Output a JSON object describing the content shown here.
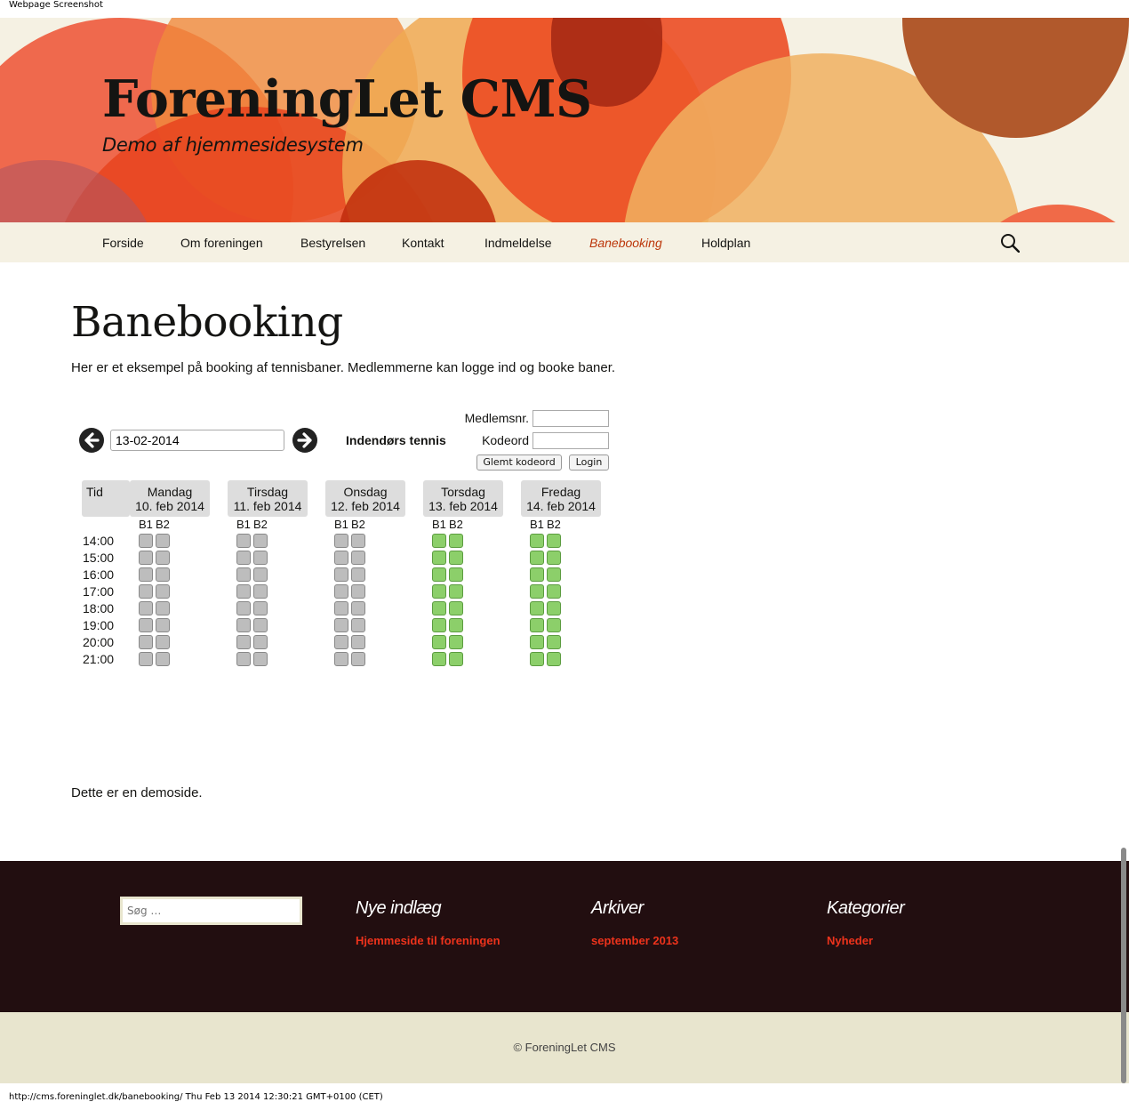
{
  "captions": {
    "top": "Webpage Screenshot",
    "bottom": "http://cms.foreninglet.dk/banebooking/ Thu Feb 13 2014 12:30:21 GMT+0100 (CET)"
  },
  "header": {
    "site_title": "ForeningLet CMS",
    "site_description": "Demo af hjemmesidesystem"
  },
  "nav": {
    "items": [
      {
        "label": "Forside"
      },
      {
        "label": "Om foreningen"
      },
      {
        "label": "Bestyrelsen"
      },
      {
        "label": "Kontakt"
      },
      {
        "label": "Indmeldelse"
      },
      {
        "label": "Banebooking",
        "active": true
      },
      {
        "label": "Holdplan"
      }
    ],
    "search_icon": "search-icon"
  },
  "main": {
    "title": "Banebooking",
    "intro": "Her er et eksempel på booking af tennisbaner. Medlemmerne kan logge ind og booke baner.",
    "demo_text": "Dette er en demoside."
  },
  "booking": {
    "date_value": "13-02-2014",
    "venue": "Indendørs tennis",
    "member_label": "Medlemsnr.",
    "password_label": "Kodeord",
    "forgot_button": "Glemt kodeord",
    "login_button": "Login",
    "time_header": "Tid",
    "courts": [
      "B1",
      "B2"
    ],
    "days": [
      {
        "name": "Mandag",
        "date": "10. feb 2014",
        "available": false
      },
      {
        "name": "Tirsdag",
        "date": "11. feb 2014",
        "available": false
      },
      {
        "name": "Onsdag",
        "date": "12. feb 2014",
        "available": false
      },
      {
        "name": "Torsdag",
        "date": "13. feb 2014",
        "available": true
      },
      {
        "name": "Fredag",
        "date": "14. feb 2014",
        "available": true
      }
    ],
    "times": [
      "14:00",
      "15:00",
      "16:00",
      "17:00",
      "18:00",
      "19:00",
      "20:00",
      "21:00"
    ],
    "colors": {
      "unavailable": "#bdbdbd",
      "available": "#8ccf6a"
    }
  },
  "footer": {
    "search_placeholder": "Søg …",
    "widgets": [
      {
        "title": "Nye indlæg",
        "link": "Hjemmeside til foreningen"
      },
      {
        "title": "Arkiver",
        "link": "september 2013"
      },
      {
        "title": "Kategorier",
        "link": "Nyheder"
      }
    ],
    "copyright": "© ForeningLet CMS"
  }
}
